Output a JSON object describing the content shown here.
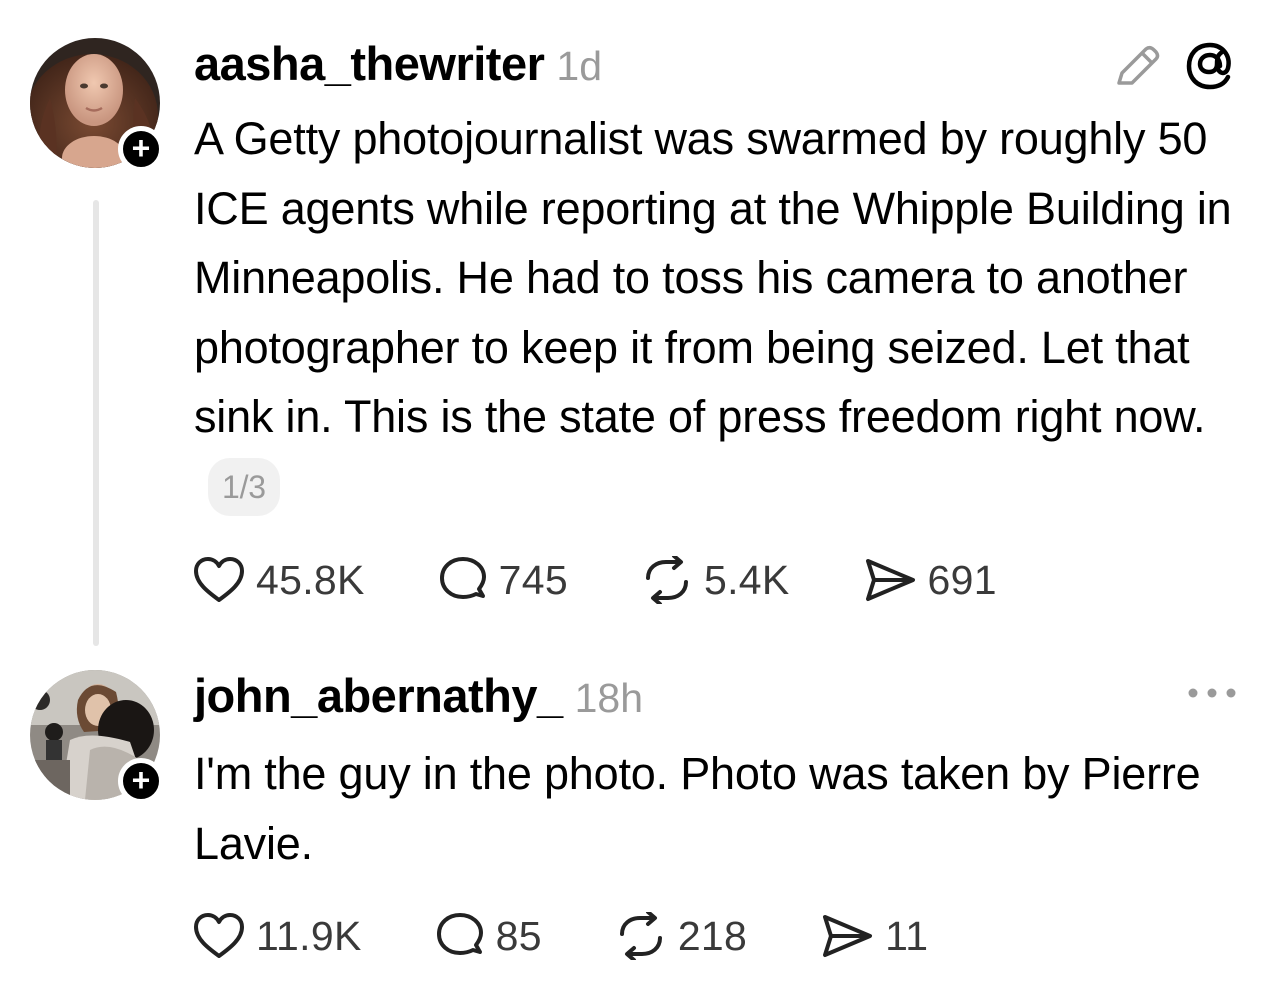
{
  "posts": [
    {
      "username": "aasha_thewriter",
      "time": "1d",
      "text": "A Getty photojournalist was swarmed by roughly 50 ICE agents while reporting at the Whipple Building in Minneapolis. He had to toss his camera to another photographer to keep it from being seized. Let that sink in. This is the state of press freedom right now.",
      "pager": "1/3",
      "likes": "45.8K",
      "replies": "745",
      "reposts": "5.4K",
      "shares": "691",
      "top_right_icons": [
        "edit-pencil-icon",
        "threads-logo-icon"
      ]
    },
    {
      "username": "john_abernathy_",
      "time": "18h",
      "text": "I'm the guy in the photo. Photo was taken by Pierre Lavie.",
      "likes": "11.9K",
      "replies": "85",
      "reposts": "218",
      "shares": "11",
      "top_right_icons": [
        "more-options-icon"
      ]
    }
  ],
  "follow_badge": "+",
  "colors": {
    "text": "#000000",
    "muted": "#9a9a9a",
    "counts": "#3a3a3a",
    "thread_line": "#e6e6e6",
    "pager_bg": "#f1f1f1"
  }
}
